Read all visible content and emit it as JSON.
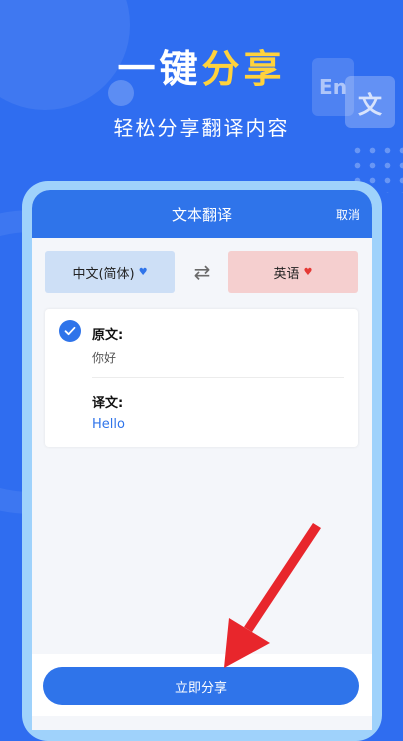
{
  "promo": {
    "headline_part1": "一键",
    "headline_part2": "分享",
    "subheadline": "轻松分享翻译内容",
    "decor_icon_en": "En",
    "decor_icon_wen": "文"
  },
  "app": {
    "title": "文本翻译",
    "cancel_label": "取消",
    "source_language": "中文(简体)",
    "target_language": "英语",
    "source_heart_icon": "♥",
    "target_heart_icon": "♥",
    "swap_icon": "⇄",
    "source_label": "原文:",
    "source_text": "你好",
    "target_label": "译文:",
    "target_text": "Hello",
    "share_button_label": "立即分享"
  },
  "colors": {
    "background": "#2f6df0",
    "accent": "#2f74ea",
    "headline_highlight": "#ffd23c",
    "arrow": "#e8262c"
  }
}
